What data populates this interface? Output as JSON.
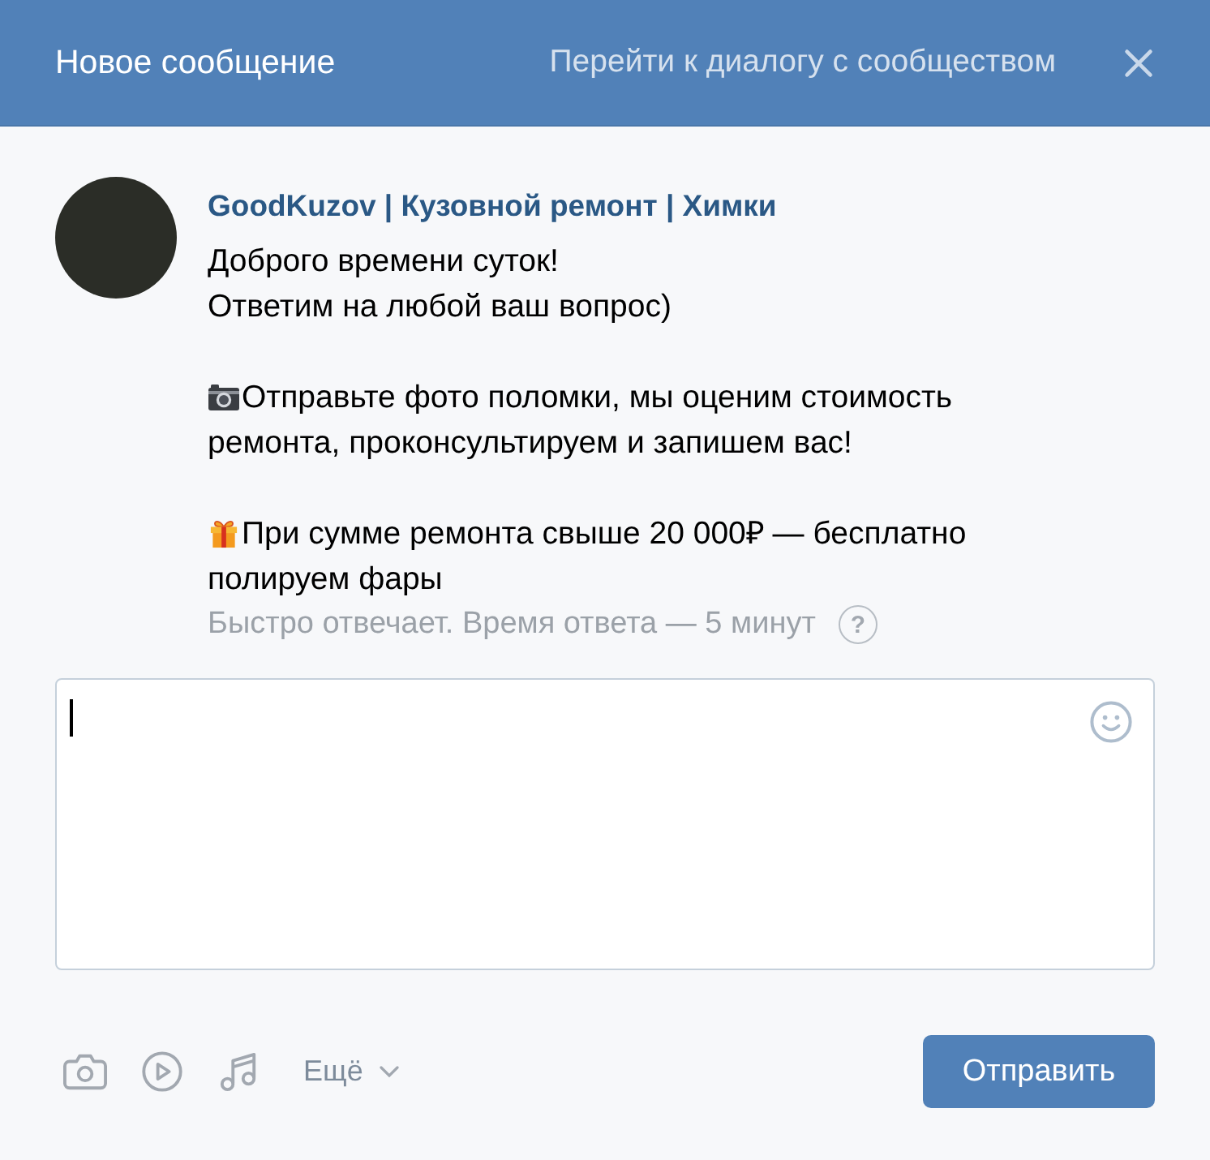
{
  "header": {
    "title": "Новое сообщение",
    "dialog_link": "Перейти к диалогу с сообществом"
  },
  "community": {
    "name": "GoodKuzov | Кузовной ремонт | Химки",
    "blocks": [
      {
        "kind": "plain",
        "lines": [
          "Доброго времени суток!",
          "Ответим на любой ваш вопрос)"
        ]
      },
      {
        "kind": "camera",
        "lines": [
          "Отправьте фото поломки, мы оценим стоимость",
          "ремонта, проконсультируем и запишем вас!"
        ]
      },
      {
        "kind": "gift",
        "lines": [
          "При сумме ремонта свыше 20 000₽ — бесплатно",
          "полируем фары"
        ]
      }
    ],
    "response_note": "Быстро отвечает. Время ответа — 5 минут",
    "help": "?"
  },
  "composer": {
    "focused": true
  },
  "toolbar": {
    "more": "Ещё",
    "send": "Отправить"
  }
}
